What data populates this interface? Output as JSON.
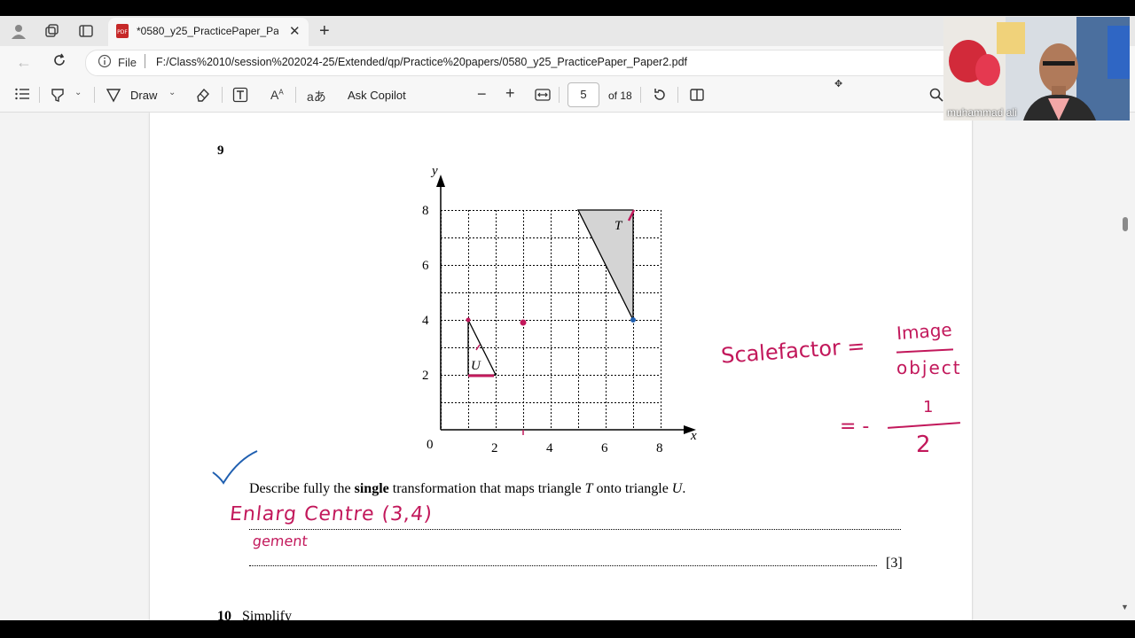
{
  "tab": {
    "title": "*0580_y25_PracticePaper_Paper2.pdf"
  },
  "address": {
    "file_label": "File",
    "url": "F:/Class%2010/session%202024-25/Extended/qp/Practice%20papers/0580_y25_PracticePaper_Paper2.pdf"
  },
  "pdf_toolbar": {
    "draw_label": "Draw",
    "ask_copilot_label": "Ask Copilot",
    "page_current": "5",
    "page_total": "of 18"
  },
  "document": {
    "question_number": "9",
    "question_text_prefix": "Describe fully the ",
    "question_text_bold": "single",
    "question_text_suffix": " transformation that maps triangle ",
    "triangle_t": "T",
    "question_text_mid": " onto triangle ",
    "triangle_u": "U",
    "question_text_end": ".",
    "marks": "[3]",
    "next_question_number": "10",
    "next_question_text": "Simplify",
    "graph": {
      "x_axis_label": "x",
      "y_axis_label": "y",
      "origin_label": "0",
      "x_ticks": [
        "2",
        "4",
        "6",
        "8"
      ],
      "y_ticks": [
        "2",
        "4",
        "6",
        "8"
      ],
      "shape_t_label": "T",
      "shape_u_label": "U"
    }
  },
  "annotations": {
    "answer_line_1": "Enlarg Centre (3,4)",
    "answer_line_2": "gement",
    "scale_factor_label": "Scalefactor =",
    "fraction_top": "Image",
    "fraction_bottom": "object",
    "result_prefix": "= -",
    "result_numerator": "1",
    "result_denominator": "2",
    "ink_color": "#c2185b",
    "tick_color": "#1f5fb0"
  },
  "webcam": {
    "participant_name": "muhammad ali"
  }
}
